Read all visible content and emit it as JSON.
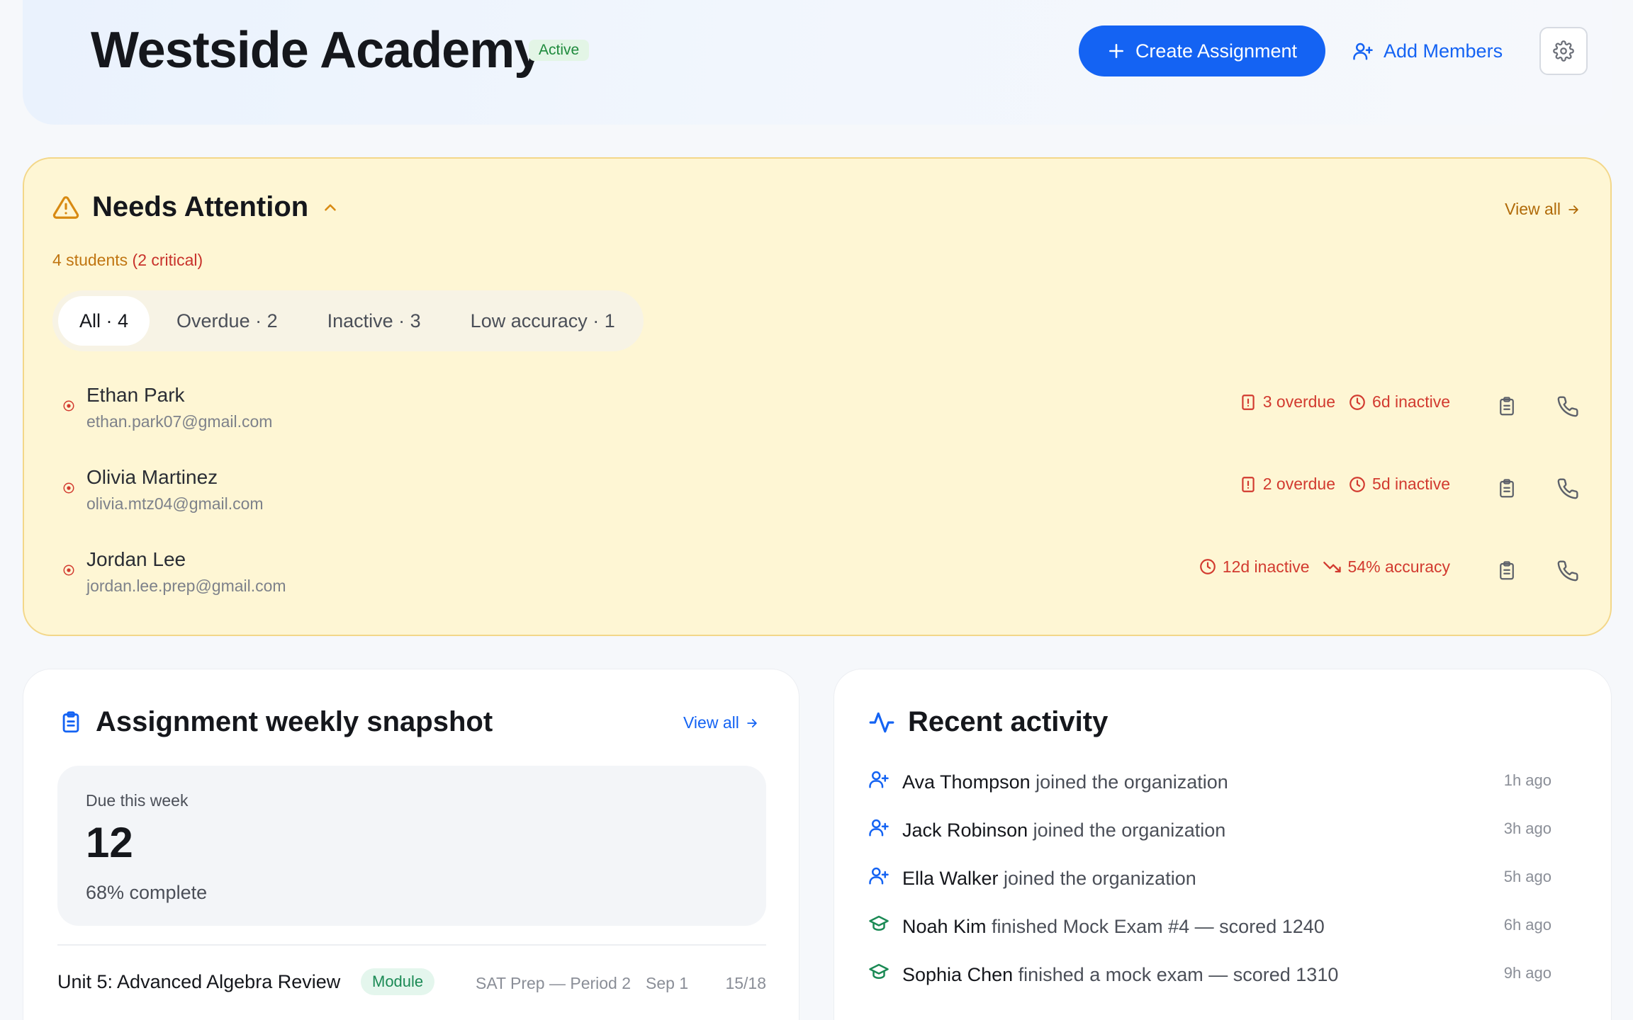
{
  "header": {
    "org_name": "Westside Academy",
    "status_badge": "Active",
    "create_button": "Create Assignment",
    "add_members_button": "Add Members"
  },
  "attention": {
    "title": "Needs Attention",
    "view_all": "View all",
    "count_text": "4 students",
    "critical_text": "(2 critical)",
    "filters": [
      {
        "label": "All · 4",
        "selected": true
      },
      {
        "label": "Overdue · 2",
        "selected": false
      },
      {
        "label": "Inactive · 3",
        "selected": false
      },
      {
        "label": "Low accuracy · 1",
        "selected": false
      }
    ],
    "students": [
      {
        "name": "Ethan Park",
        "email": "ethan.park07@gmail.com",
        "tags": [
          "3 overdue",
          "6d inactive"
        ]
      },
      {
        "name": "Olivia Martinez",
        "email": "olivia.mtz04@gmail.com",
        "tags": [
          "2 overdue",
          "5d inactive"
        ]
      },
      {
        "name": "Jordan Lee",
        "email": "jordan.lee.prep@gmail.com",
        "tags": [
          "12d inactive",
          "54% accuracy"
        ]
      }
    ]
  },
  "assignments": {
    "title": "Assignment weekly snapshot",
    "view_all": "View all",
    "due_label": "Due this week",
    "due_count": "12",
    "complete_text": "68% complete",
    "rows": [
      {
        "name": "Unit 5: Advanced Algebra Review",
        "type": "Module",
        "class": "SAT Prep — Period 2",
        "date": "Sep 1",
        "count": "15/18"
      }
    ]
  },
  "activity": {
    "title": "Recent activity",
    "items": [
      {
        "icon": "user-plus-icon",
        "who": "Ava Thompson",
        "action": " joined the organization",
        "time": "1h ago"
      },
      {
        "icon": "user-plus-icon",
        "who": "Jack Robinson",
        "action": " joined the organization",
        "time": "3h ago"
      },
      {
        "icon": "user-plus-icon",
        "who": "Ella Walker",
        "action": " joined the organization",
        "time": "5h ago"
      },
      {
        "icon": "graduation-cap-icon",
        "who": "Noah Kim",
        "action": " finished Mock Exam #4 — scored 1240",
        "time": "6h ago"
      },
      {
        "icon": "graduation-cap-icon",
        "who": "Sophia Chen",
        "action": " finished a mock exam — scored 1310",
        "time": "9h ago"
      }
    ]
  },
  "colors": {
    "accent": "#1463f3",
    "warning_bg": "#fef6d4",
    "danger": "#d23a2f",
    "success": "#1b8a55"
  }
}
